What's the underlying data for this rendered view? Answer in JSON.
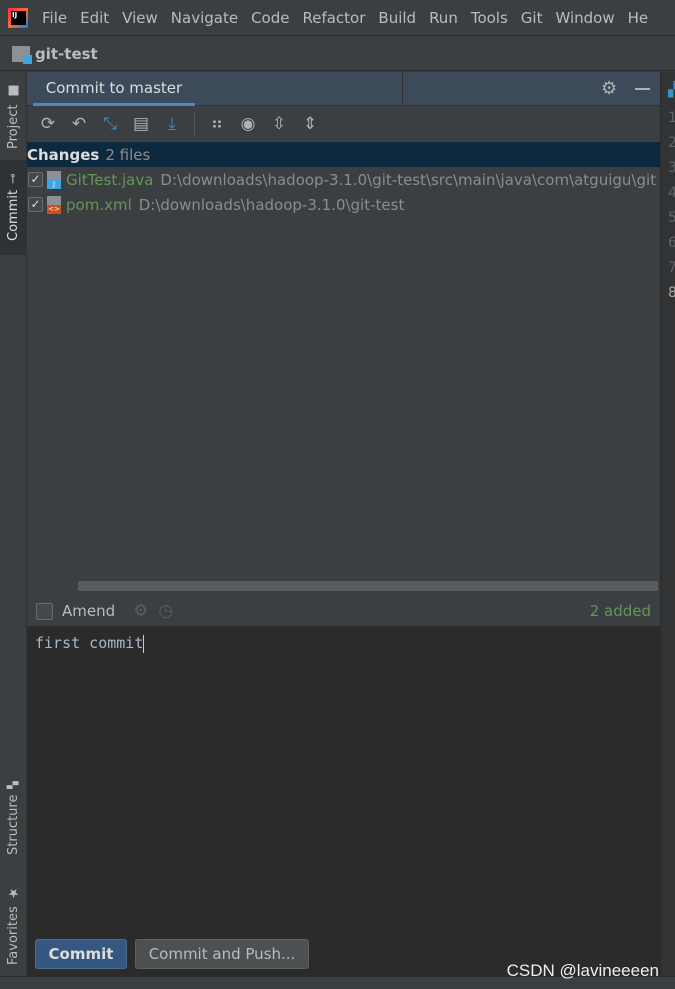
{
  "menu": [
    "File",
    "Edit",
    "View",
    "Navigate",
    "Code",
    "Refactor",
    "Build",
    "Run",
    "Tools",
    "Git",
    "Window",
    "He"
  ],
  "project": "git-test",
  "side_tabs": {
    "project": "Project",
    "commit": "Commit",
    "structure": "Structure",
    "favorites": "Favorites"
  },
  "panel": {
    "tab_title": "Commit to master"
  },
  "changes": {
    "label": "Changes",
    "count": "2 files",
    "files": [
      {
        "name": "GitTest.java",
        "path": "D:\\downloads\\hadoop-3.1.0\\git-test\\src\\main\\java\\com\\atguigu\\git",
        "icon": "java-file-icon",
        "checked": true
      },
      {
        "name": "pom.xml",
        "path": "D:\\downloads\\hadoop-3.1.0\\git-test",
        "icon": "xml-file-icon",
        "checked": true
      }
    ]
  },
  "amend": {
    "label": "Amend",
    "checked": false,
    "summary": "2 added"
  },
  "commit_message": "first commit",
  "buttons": {
    "commit": "Commit",
    "commit_push": "Commit and Push..."
  },
  "gutter_lines": [
    "1",
    "2",
    "3",
    "4",
    "5",
    "6",
    "7",
    "8"
  ],
  "watermark": "CSDN @lavineeeen",
  "colors": {
    "accent": "#4a88c7",
    "added": "#629755",
    "selected_row": "#0d293e"
  }
}
